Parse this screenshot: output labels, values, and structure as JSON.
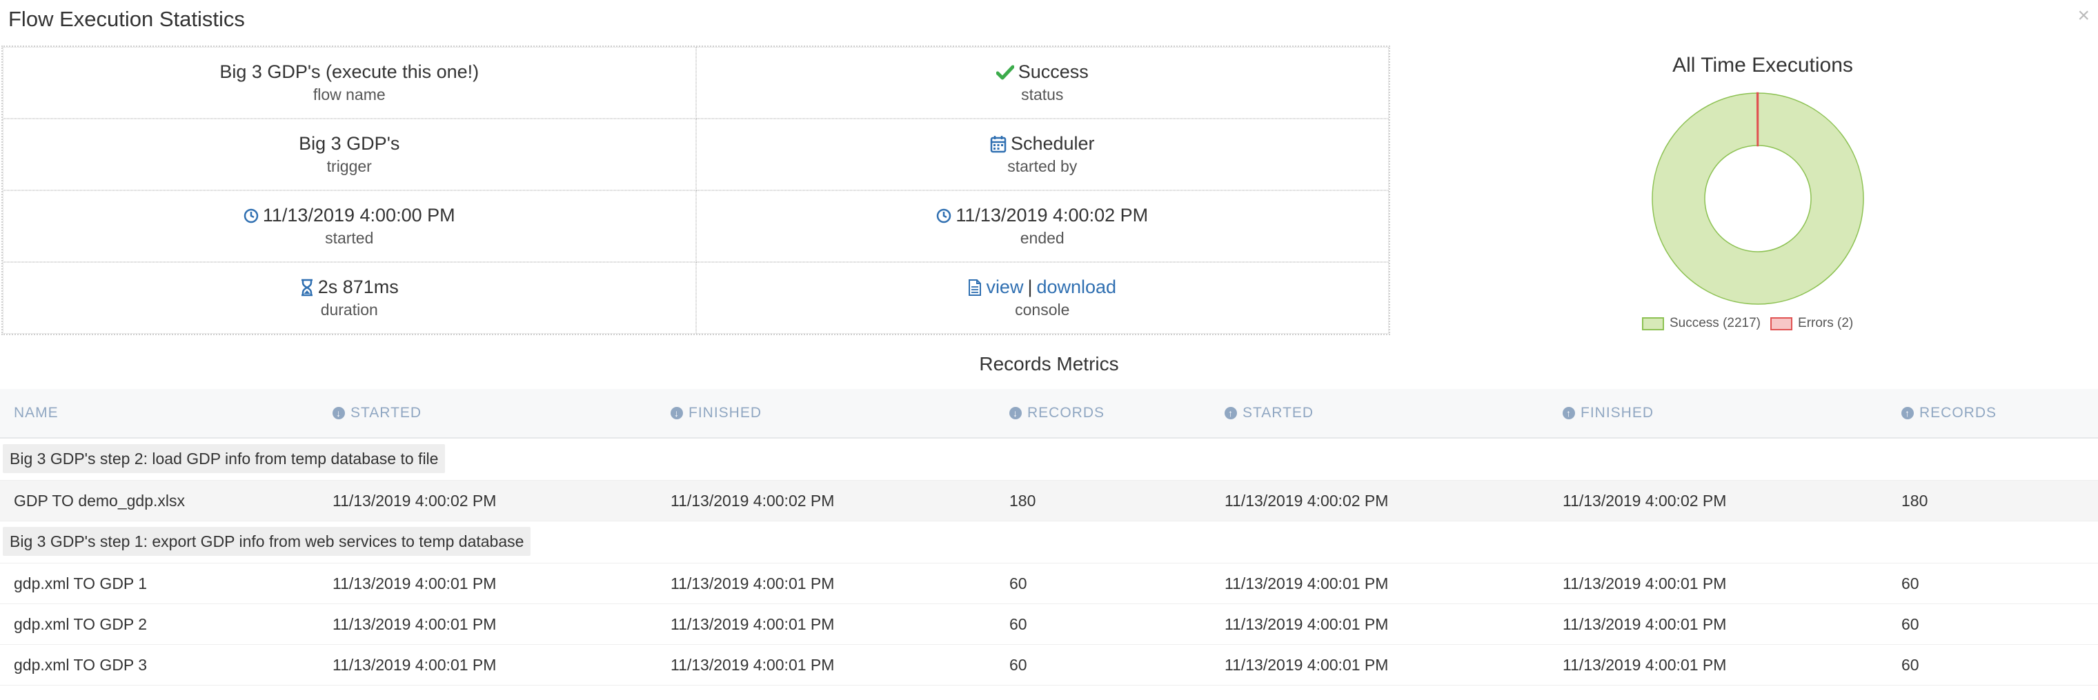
{
  "window": {
    "title": "Flow Execution Statistics",
    "close_label": "×"
  },
  "stats": {
    "flow_name": {
      "value": "Big 3 GDP's (execute this one!)",
      "label": "flow name"
    },
    "status": {
      "value": "Success",
      "label": "status",
      "icon": "checkmark-icon"
    },
    "trigger": {
      "value": "Big 3 GDP's",
      "label": "trigger"
    },
    "started_by": {
      "value": "Scheduler",
      "label": "started by",
      "icon": "calendar-icon"
    },
    "started": {
      "value": "11/13/2019 4:00:00 PM",
      "label": "started",
      "icon": "clock-icon"
    },
    "ended": {
      "value": "11/13/2019 4:00:02 PM",
      "label": "ended",
      "icon": "clock-icon"
    },
    "duration": {
      "value": "2s 871ms",
      "label": "duration",
      "icon": "hourglass-icon"
    },
    "console": {
      "view": "view",
      "separator": "|",
      "download": "download",
      "label": "console",
      "icon": "document-icon"
    }
  },
  "chart_data": {
    "type": "pie",
    "title": "All Time Executions",
    "categories": [
      "Success (2217)",
      "Errors (2)"
    ],
    "values": [
      2217,
      2
    ],
    "colors": {
      "fill": [
        "#d7e9b8",
        "#f7c6c6"
      ],
      "stroke": [
        "#8cc152",
        "#e05252"
      ]
    },
    "legend_position": "bottom"
  },
  "records": {
    "title": "Records Metrics",
    "columns": [
      "NAME",
      "STARTED",
      "FINISHED",
      "RECORDS",
      "STARTED",
      "FINISHED",
      "RECORDS"
    ],
    "groups": [
      {
        "label": "Big 3 GDP's step 2: load GDP info from temp database to file",
        "rows": [
          [
            "GDP TO demo_gdp.xlsx",
            "11/13/2019 4:00:02 PM",
            "11/13/2019 4:00:02 PM",
            "180",
            "11/13/2019 4:00:02 PM",
            "11/13/2019 4:00:02 PM",
            "180"
          ]
        ]
      },
      {
        "label": "Big 3 GDP's step 1: export GDP info from web services to temp database",
        "rows": [
          [
            "gdp.xml TO GDP 1",
            "11/13/2019 4:00:01 PM",
            "11/13/2019 4:00:01 PM",
            "60",
            "11/13/2019 4:00:01 PM",
            "11/13/2019 4:00:01 PM",
            "60"
          ],
          [
            "gdp.xml TO GDP 2",
            "11/13/2019 4:00:01 PM",
            "11/13/2019 4:00:01 PM",
            "60",
            "11/13/2019 4:00:01 PM",
            "11/13/2019 4:00:01 PM",
            "60"
          ],
          [
            "gdp.xml TO GDP 3",
            "11/13/2019 4:00:01 PM",
            "11/13/2019 4:00:01 PM",
            "60",
            "11/13/2019 4:00:01 PM",
            "11/13/2019 4:00:01 PM",
            "60"
          ]
        ]
      }
    ]
  },
  "colors": {
    "accent": "#2f6fb1",
    "success": "#3cab4b",
    "header_text": "#90a7c2"
  }
}
